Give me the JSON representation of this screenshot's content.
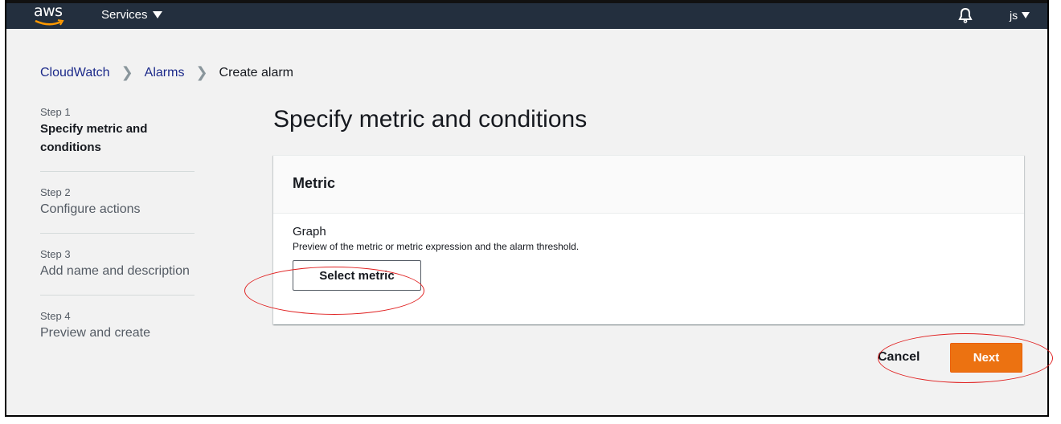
{
  "navbar": {
    "logo_text": "aws",
    "services_label": "Services",
    "user_label": "js"
  },
  "breadcrumb": [
    {
      "label": "CloudWatch"
    },
    {
      "label": "Alarms"
    },
    {
      "label": "Create alarm"
    }
  ],
  "steps": [
    {
      "number": "Step 1",
      "title": "Specify metric and conditions",
      "active": true
    },
    {
      "number": "Step 2",
      "title": "Configure actions",
      "active": false
    },
    {
      "number": "Step 3",
      "title": "Add name and description",
      "active": false
    },
    {
      "number": "Step 4",
      "title": "Preview and create",
      "active": false
    }
  ],
  "main": {
    "title": "Specify metric and conditions",
    "card": {
      "title": "Metric",
      "field_label": "Graph",
      "field_description": "Preview of the metric or metric expression and the alarm threshold.",
      "select_button": "Select metric"
    },
    "cancel_label": "Cancel",
    "next_label": "Next"
  },
  "colors": {
    "navbar_bg": "#232f3e",
    "primary": "#ec7211",
    "link": "#1c2a8a",
    "annotation": "#e02020"
  }
}
